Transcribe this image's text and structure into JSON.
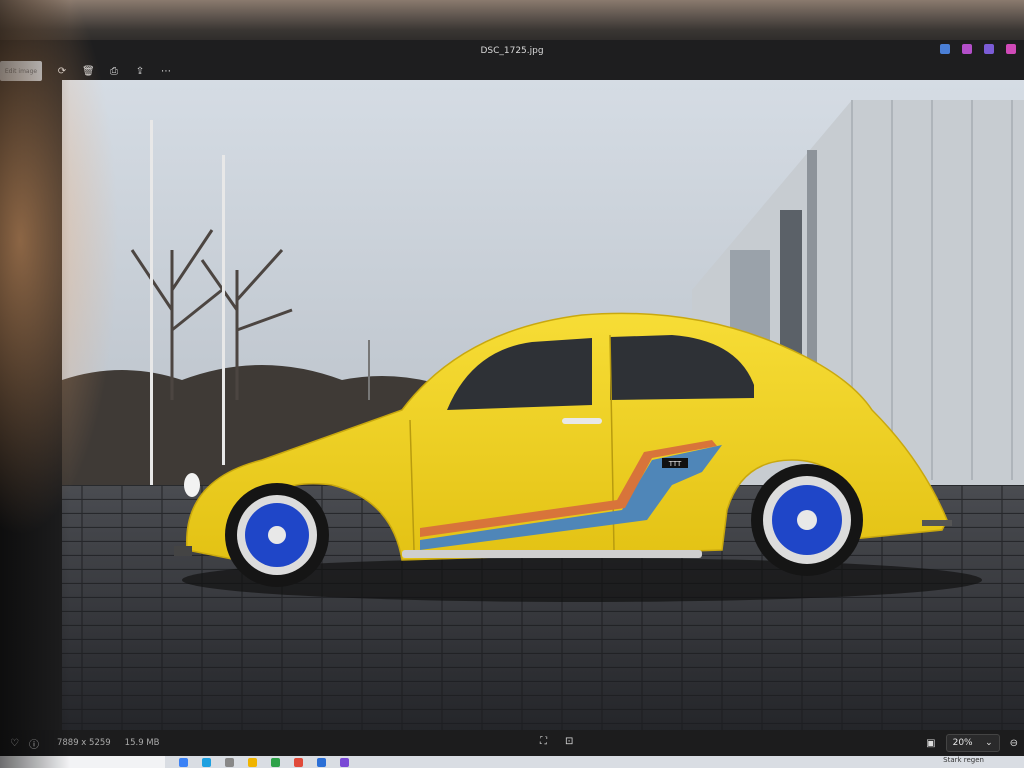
{
  "window": {
    "title": "DSC_1725.jpg"
  },
  "toolbar": {
    "edit_label": "Edit image",
    "icons": [
      "rotate-icon",
      "delete-icon",
      "print-icon",
      "share-icon",
      "more-icon"
    ]
  },
  "statusbar": {
    "dimensions": "7889 x 5259",
    "file_size": "15.9 MB",
    "zoom": "20%"
  },
  "photo": {
    "car_plate": "TTT",
    "colors": {
      "car_body": "#f2d21e",
      "sky": "#c9d0d8",
      "pavement": "#2c2e33",
      "stripe_orange": "#d8743a",
      "stripe_blue": "#4f86b8",
      "wheel_blue": "#1f46c8"
    }
  },
  "taskbar": {
    "tray_text": "Stark regen"
  }
}
